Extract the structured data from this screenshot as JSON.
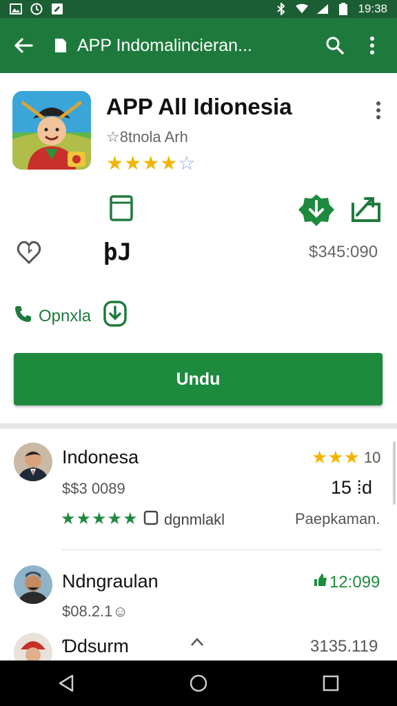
{
  "status_bar": {
    "time": "19:38",
    "left_icons": [
      "gallery-icon",
      "clock-icon",
      "edit-icon"
    ],
    "right_icons": [
      "bluetooth-icon",
      "wifi-icon",
      "signal-icon",
      "battery-icon"
    ]
  },
  "toolbar": {
    "title": "APP Indomalincieran...",
    "back_icon": "arrow-back-icon",
    "doc_icon": "document-icon",
    "search_icon": "search-icon",
    "more_icon": "more-vert-icon"
  },
  "app": {
    "title": "APP All Idionesia",
    "developer": "☆8tnola Arh",
    "rating_stars": "★★★★",
    "rating_empty_star": "☆",
    "code": "þJ",
    "price": "$345:090",
    "open_label": "Opnxla",
    "install_label": "Undu"
  },
  "list": [
    {
      "name": "Indonesa",
      "sub": "$$3 0089",
      "right_top": "10",
      "right_mid": "15 ⁞d",
      "stars": "★★★★★",
      "tag": "dgnmlakl",
      "status": "Paepkaman."
    },
    {
      "name": "Ndngraulan",
      "sub": "$08.2.1☺",
      "right_top": "12:099"
    },
    {
      "name": "Ɗdsurm",
      "right_top": "3135.119"
    }
  ],
  "colors": {
    "status_bar": "#1b5e34",
    "toolbar": "#1e7a3c",
    "accent": "#1e8a3e",
    "star": "#f4b400"
  }
}
